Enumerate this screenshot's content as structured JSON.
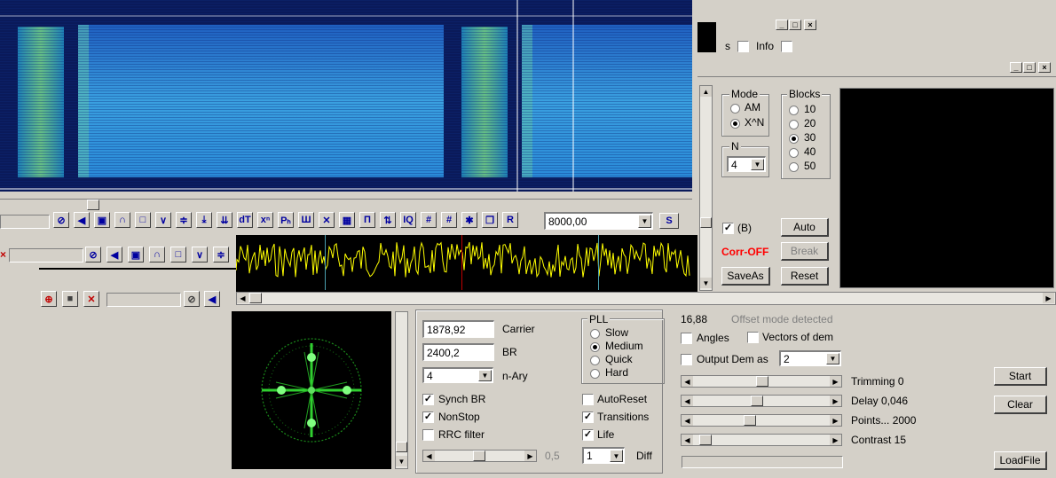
{
  "colors": {
    "spectrogram_bg": "#0a1a5a",
    "wave_trace": "#ffff00",
    "carrier_line": "#c00000",
    "scope_bg": "#000000",
    "constellation": "#00ff00",
    "warning": "#ff0000"
  },
  "spectrogram": {
    "freq_value": "8000,00",
    "s_label": "S"
  },
  "toolbar_icons": [
    "stop-icon",
    "speaker-icon",
    "square-icon",
    "arch-icon",
    "rect-icon",
    "valley-icon",
    "notch-icon",
    "arrow-down-bar-icon",
    "arrow-double-down-icon",
    "dt-icon",
    "xn-icon",
    "ph-icon",
    "comb-icon",
    "cross-arrows-icon",
    "grid-icon",
    "pulse-icon",
    "swap-icon",
    "iq-icon",
    "hash-icon",
    "hash-alt-icon",
    "gear-icon",
    "copy-icon",
    "r-icon"
  ],
  "toolbar_text": {
    "dt": "dT",
    "xn": "x",
    "ph": "P",
    "iq": "IQ",
    "r": "R"
  },
  "small_window": {
    "speed_label": "s",
    "info_label": "Info"
  },
  "corr_panel": {
    "mode_title": "Mode",
    "mode_options": [
      "AM",
      "X^N"
    ],
    "mode_selected": "X^N",
    "blocks_title": "Blocks",
    "blocks_options": [
      "10",
      "20",
      "30",
      "40",
      "50"
    ],
    "blocks_selected": "30",
    "n_title": "N",
    "n_value": "4",
    "b_check_label": "(B)",
    "b_checked": true,
    "corr_status": "Corr-OFF",
    "auto": "Auto",
    "break": "Break",
    "saveas": "SaveAs",
    "reset": "Reset"
  },
  "demod": {
    "carrier_value": "1878,92",
    "carrier_label": "Carrier",
    "br_value": "2400,2",
    "br_label": "BR",
    "nary_value": "4",
    "nary_label": "n-Ary",
    "synch_br": "Synch BR",
    "nonstop": "NonStop",
    "rrc_filter": "RRC filter",
    "rolloff_value": "0,5",
    "pll_title": "PLL",
    "pll_options": [
      "Slow",
      "Medium",
      "Quick",
      "Hard"
    ],
    "pll_selected": "Medium",
    "autoreset": "AutoReset",
    "transitions": "Transitions",
    "life": "Life",
    "diff_value": "1",
    "diff_label": "Diff"
  },
  "right_panel": {
    "offset_value": "16,88",
    "offset_status": "Offset mode detected",
    "angles": "Angles",
    "vectors": "Vectors of dem",
    "output_dem": "Output Dem as",
    "output_value": "2",
    "trimming": "Trimming 0",
    "delay": "Delay  0,046",
    "points": "Points... 2000",
    "contrast": "Contrast 15",
    "start": "Start",
    "clear": "Clear",
    "loadfile": "LoadFile"
  }
}
